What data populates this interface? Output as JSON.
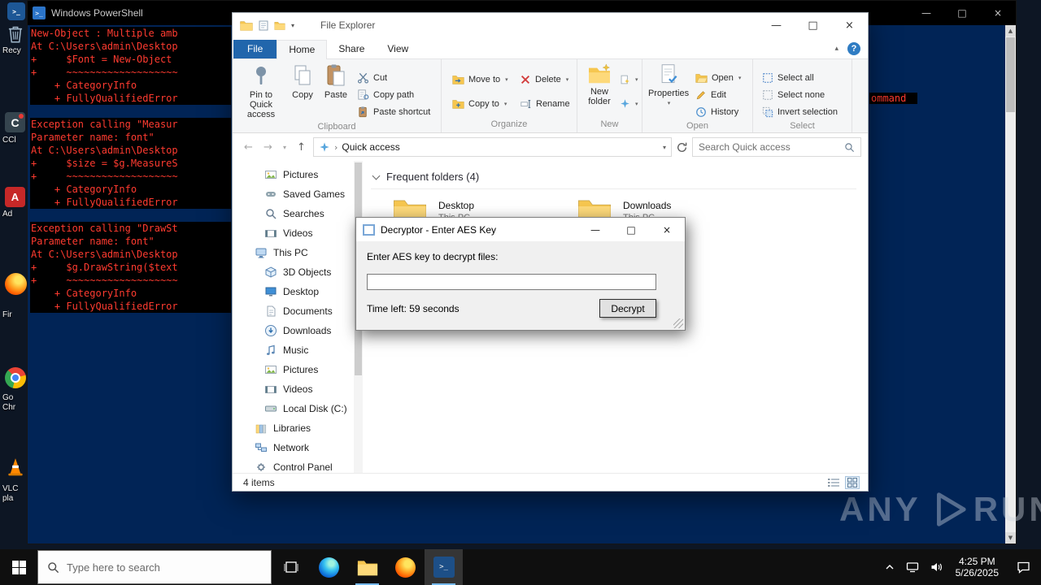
{
  "desktop": {
    "icons": {
      "recycle_bin_label": "Recy",
      "ccleaner_label": "CCl",
      "adobe_label": "Ad",
      "firefox_label": "Fir",
      "chrome_label_line1": "Go",
      "chrome_label_line2": "Chr",
      "vlc_label_line1": "VLC",
      "vlc_label_line2": "pla"
    },
    "watermark_left": "ANY",
    "watermark_right": "RUN"
  },
  "powershell": {
    "window_title": "Windows PowerShell",
    "console_lines": [
      "New-Object : Multiple amb",
      "At C:\\Users\\admin\\Desktop",
      "+     $Font = New-Object",
      "+     ~~~~~~~~~~~~~~~~~~~",
      "    + CategoryInfo",
      "    + FullyQualifiedError",
      "",
      "Exception calling \"Measur",
      "Parameter name: font\"",
      "At C:\\Users\\admin\\Desktop",
      "+     $size = $g.MeasureS",
      "+     ~~~~~~~~~~~~~~~~~~~",
      "    + CategoryInfo",
      "    + FullyQualifiedError",
      "",
      "Exception calling \"DrawSt",
      "Parameter name: font\"",
      "At C:\\Users\\admin\\Desktop",
      "+     $g.DrawString($text",
      "+     ~~~~~~~~~~~~~~~~~~~",
      "    + CategoryInfo",
      "    + FullyQualifiedError"
    ],
    "clipped_fragment": "ommand"
  },
  "explorer": {
    "window_title": "File Explorer",
    "tabs": {
      "file": "File",
      "home": "Home",
      "share": "Share",
      "view": "View"
    },
    "ribbon": {
      "clipboard": {
        "label": "Clipboard",
        "pin": "Pin to Quick access",
        "copy": "Copy",
        "paste": "Paste",
        "cut": "Cut",
        "copy_path": "Copy path",
        "paste_shortcut": "Paste shortcut"
      },
      "organize": {
        "label": "Organize",
        "move_to": "Move to",
        "copy_to": "Copy to",
        "delete": "Delete",
        "rename": "Rename"
      },
      "new_group": {
        "label": "New",
        "new_folder": "New folder"
      },
      "open_group": {
        "label": "Open",
        "properties": "Properties",
        "open": "Open",
        "edit": "Edit",
        "history": "History"
      },
      "select_group": {
        "label": "Select",
        "select_all": "Select all",
        "select_none": "Select none",
        "invert_selection": "Invert selection"
      }
    },
    "address_bar": {
      "location": "Quick access",
      "search_placeholder": "Search Quick access"
    },
    "navigation": {
      "items": [
        {
          "label": "Pictures"
        },
        {
          "label": "Saved Games"
        },
        {
          "label": "Searches"
        },
        {
          "label": "Videos"
        },
        {
          "label": "This PC"
        },
        {
          "label": "3D Objects"
        },
        {
          "label": "Desktop"
        },
        {
          "label": "Documents"
        },
        {
          "label": "Downloads"
        },
        {
          "label": "Music"
        },
        {
          "label": "Pictures"
        },
        {
          "label": "Videos"
        },
        {
          "label": "Local Disk (C:)"
        },
        {
          "label": "Libraries"
        },
        {
          "label": "Network"
        },
        {
          "label": "Control Panel"
        }
      ]
    },
    "content": {
      "section_header": "Frequent folders (4)",
      "folders": [
        {
          "name": "Desktop",
          "location": "This PC"
        },
        {
          "name": "Downloads",
          "location": "This PC"
        }
      ]
    },
    "status_bar": {
      "items_count": "4 items"
    }
  },
  "decryptor_dialog": {
    "title": "Decryptor - Enter AES Key",
    "prompt": "Enter AES key to decrypt files:",
    "key_input_value": "",
    "time_left": "Time left: 59 seconds",
    "decrypt_button": "Decrypt"
  },
  "taskbar": {
    "search_placeholder": "Type here to search",
    "clock_time": "4:25 PM",
    "clock_date": "5/26/2025"
  }
}
